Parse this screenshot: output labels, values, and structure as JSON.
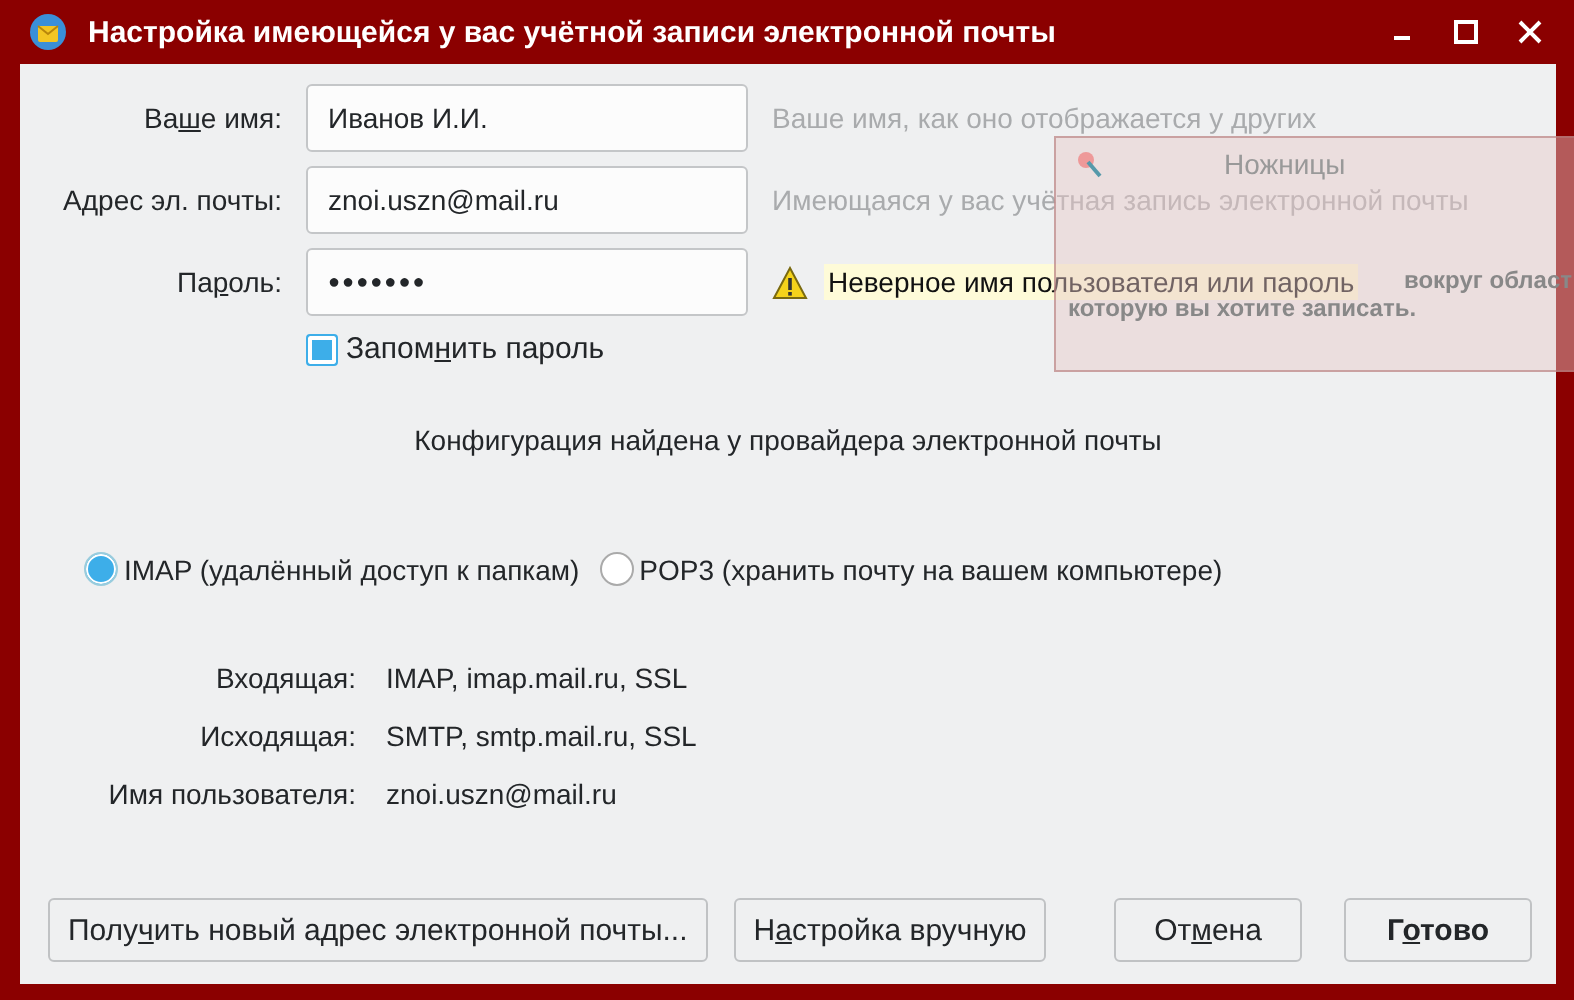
{
  "window": {
    "title": "Настройка имеющейся у вас учётной записи электронной почты"
  },
  "fields": [
    {
      "label": [
        "Ва",
        "ш",
        "е имя:"
      ],
      "kind": "text",
      "value": "Иванов И.И.",
      "hint": "Ваше имя, как оно отображается у других"
    },
    {
      "label": [
        "А",
        "д",
        "рес эл. почты:"
      ],
      "kind": "text",
      "value": "znoi.uszn@mail.ru",
      "hint": "Имеющаяся у вас учётная запись электронной почты"
    },
    {
      "label": [
        "Па",
        "р",
        "оль:"
      ],
      "kind": "password",
      "value": "●●●●●●●",
      "error": "Неверное имя пользователя или пароль"
    }
  ],
  "remember": {
    "label": [
      "Запом",
      "н",
      "ить пароль"
    ],
    "checked": true
  },
  "config_message": "Конфигурация найдена у провайдера электронной почты",
  "protocols": [
    {
      "label": "IMAP (удалённый доступ к папкам)",
      "selected": true
    },
    {
      "label": "POP3 (хранить почту на вашем компьютере)",
      "selected": false
    }
  ],
  "servers": [
    {
      "label": "Входящая:",
      "value": "IMAP, imap.mail.ru, SSL"
    },
    {
      "label": "Исходящая:",
      "value": "SMTP, smtp.mail.ru, SSL"
    },
    {
      "label": "Имя пользователя:",
      "value": "znoi.uszn@mail.ru"
    }
  ],
  "buttons": [
    {
      "label": [
        "Полу",
        "ч",
        "ить новый адрес электронной почты..."
      ],
      "default": false
    },
    {
      "label": [
        "Н",
        "а",
        "стройка вручную"
      ],
      "default": false
    },
    {
      "label": [
        "От",
        "м",
        "ена"
      ],
      "default": false
    },
    {
      "label": [
        "Г",
        "о",
        "тово"
      ],
      "default": true
    }
  ],
  "overlay_window": {
    "title": "Ножницы",
    "text_lines": [
      "вокруг област",
      "которую вы хотите записать."
    ]
  }
}
